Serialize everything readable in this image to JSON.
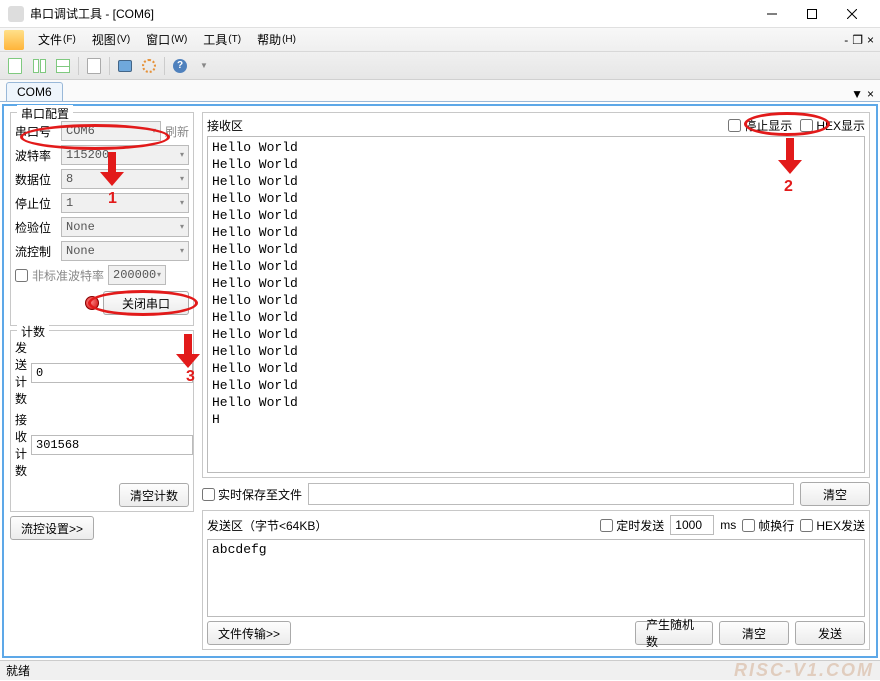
{
  "window": {
    "title": "串口调试工具 - [COM6]"
  },
  "menus": {
    "file": "文件",
    "file_k": "(F)",
    "view": "视图",
    "view_k": "(V)",
    "window": "窗口",
    "window_k": "(W)",
    "tool": "工具",
    "tool_k": "(T)",
    "help": "帮助",
    "help_k": "(H)"
  },
  "tab": {
    "name": "COM6"
  },
  "config": {
    "group_title": "串口配置",
    "port_label": "串口号",
    "port_value": "COM6",
    "refresh": "刷新",
    "baud_label": "波特率",
    "baud_value": "115200",
    "data_label": "数据位",
    "data_value": "8",
    "stop_label": "停止位",
    "stop_value": "1",
    "parity_label": "检验位",
    "parity_value": "None",
    "flow_label": "流控制",
    "flow_value": "None",
    "nonstd_label": "非标准波特率",
    "nonstd_value": "200000",
    "close_btn": "关闭串口"
  },
  "count": {
    "group_title": "计数",
    "send_label": "发送计数",
    "send_value": "0",
    "recv_label": "接收计数",
    "recv_value": "301568",
    "clear_btn": "清空计数"
  },
  "flowset_btn": "流控设置>>",
  "recv": {
    "title": "接收区",
    "stop_disp": "停止显示",
    "hex_disp": "HEX显示",
    "text": "Hello World\nHello World\nHello World\nHello World\nHello World\nHello World\nHello World\nHello World\nHello World\nHello World\nHello World\nHello World\nHello World\nHello World\nHello World\nHello World\nH",
    "save_label": "实时保存至文件",
    "clear_btn": "清空"
  },
  "send": {
    "title": "发送区（字节<64KB）",
    "timed": "定时发送",
    "interval": "1000",
    "ms": "ms",
    "wrap": "帧换行",
    "hex": "HEX发送",
    "text": "abcdefg",
    "filetrans": "文件传输>>",
    "random": "产生随机数",
    "clear": "清空",
    "send_btn": "发送"
  },
  "status": {
    "ready": "就绪",
    "watermark": "RISC-V1.COM"
  }
}
